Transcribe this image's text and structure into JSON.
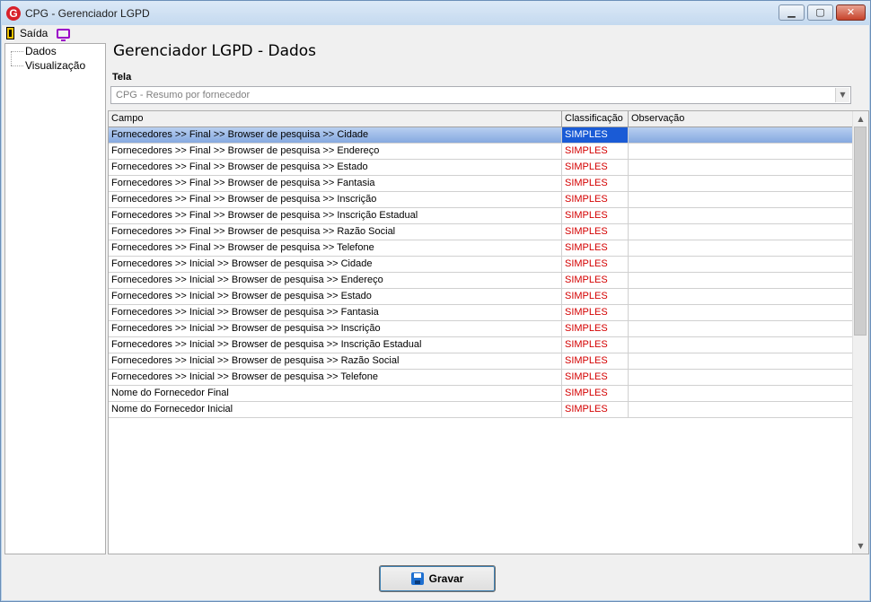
{
  "window": {
    "title": "CPG - Gerenciador LGPD",
    "minimize_glyph": "▁",
    "maximize_glyph": "▢",
    "close_glyph": "✕"
  },
  "menu": {
    "exit_label": "Saída",
    "exit_icon": "exit-door-icon",
    "monitor_icon": "monitor-icon"
  },
  "tree": {
    "items": [
      {
        "label": "Dados"
      },
      {
        "label": "Visualização"
      }
    ]
  },
  "main": {
    "title": "Gerenciador LGPD - Dados",
    "tela_label": "Tela",
    "tela_value": "CPG - Resumo por fornecedor"
  },
  "grid": {
    "columns": [
      "Campo",
      "Classificação",
      "Observação"
    ],
    "selected_row": 0,
    "rows": [
      {
        "campo": "Fornecedores >> Final >> Browser de pesquisa >> Cidade",
        "classificacao": "SIMPLES",
        "observacao": ""
      },
      {
        "campo": "Fornecedores >> Final >> Browser de pesquisa >> Endereço",
        "classificacao": "SIMPLES",
        "observacao": ""
      },
      {
        "campo": "Fornecedores >> Final >> Browser de pesquisa >> Estado",
        "classificacao": "SIMPLES",
        "observacao": ""
      },
      {
        "campo": "Fornecedores >> Final >> Browser de pesquisa >> Fantasia",
        "classificacao": "SIMPLES",
        "observacao": ""
      },
      {
        "campo": "Fornecedores >> Final >> Browser de pesquisa >> Inscrição",
        "classificacao": "SIMPLES",
        "observacao": ""
      },
      {
        "campo": "Fornecedores >> Final >> Browser de pesquisa >> Inscrição Estadual",
        "classificacao": "SIMPLES",
        "observacao": ""
      },
      {
        "campo": "Fornecedores >> Final >> Browser de pesquisa >> Razão Social",
        "classificacao": "SIMPLES",
        "observacao": ""
      },
      {
        "campo": "Fornecedores >> Final >> Browser de pesquisa >> Telefone",
        "classificacao": "SIMPLES",
        "observacao": ""
      },
      {
        "campo": "Fornecedores >> Inicial >> Browser de pesquisa >> Cidade",
        "classificacao": "SIMPLES",
        "observacao": ""
      },
      {
        "campo": "Fornecedores >> Inicial >> Browser de pesquisa >> Endereço",
        "classificacao": "SIMPLES",
        "observacao": ""
      },
      {
        "campo": "Fornecedores >> Inicial >> Browser de pesquisa >> Estado",
        "classificacao": "SIMPLES",
        "observacao": ""
      },
      {
        "campo": "Fornecedores >> Inicial >> Browser de pesquisa >> Fantasia",
        "classificacao": "SIMPLES",
        "observacao": ""
      },
      {
        "campo": "Fornecedores >> Inicial >> Browser de pesquisa >> Inscrição",
        "classificacao": "SIMPLES",
        "observacao": ""
      },
      {
        "campo": "Fornecedores >> Inicial >> Browser de pesquisa >> Inscrição Estadual",
        "classificacao": "SIMPLES",
        "observacao": ""
      },
      {
        "campo": "Fornecedores >> Inicial >> Browser de pesquisa >> Razão Social",
        "classificacao": "SIMPLES",
        "observacao": ""
      },
      {
        "campo": "Fornecedores >> Inicial >> Browser de pesquisa >> Telefone",
        "classificacao": "SIMPLES",
        "observacao": ""
      },
      {
        "campo": "Nome do Fornecedor Final",
        "classificacao": "SIMPLES",
        "observacao": ""
      },
      {
        "campo": "Nome do Fornecedor Inicial",
        "classificacao": "SIMPLES",
        "observacao": ""
      }
    ]
  },
  "footer": {
    "save_label": "Gravar",
    "save_icon": "floppy-disk-icon"
  }
}
